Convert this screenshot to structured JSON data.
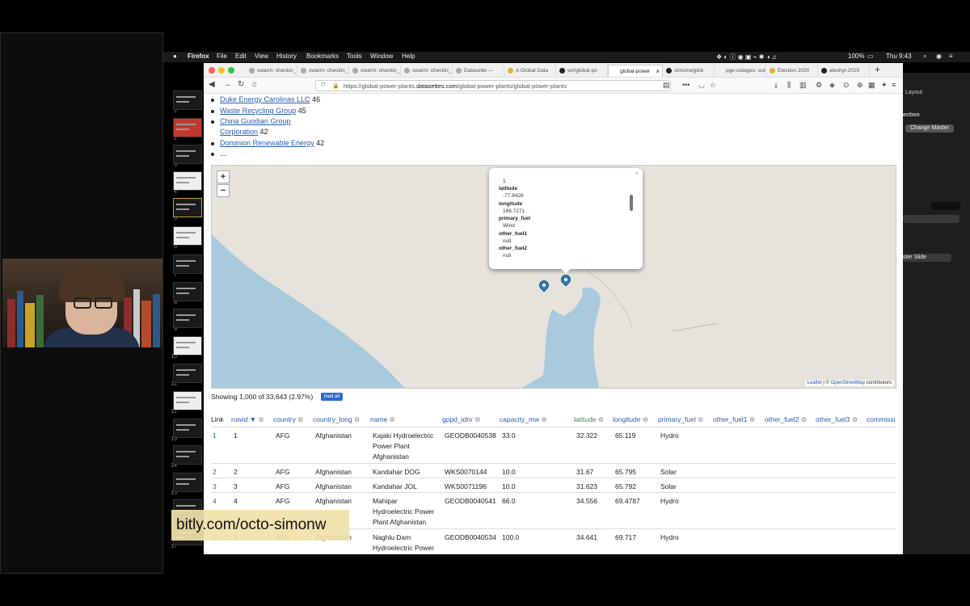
{
  "menubar": {
    "apple": "",
    "app": "Firefox",
    "items": [
      "File",
      "Edit",
      "View",
      "History",
      "Bookmarks",
      "Tools",
      "Window",
      "Help"
    ],
    "battery": "100%",
    "clock": "Thu 9:43"
  },
  "tabs": [
    {
      "label": "swarm: checkin_"
    },
    {
      "label": "swarm: checkin_"
    },
    {
      "label": "swarm: checkin_"
    },
    {
      "label": "swarm: checkin_"
    },
    {
      "label": "Datasette —"
    },
    {
      "label": "A Global Data"
    },
    {
      "label": "wri/global-po"
    },
    {
      "label": "global-power",
      "active": true
    },
    {
      "label": "simonw/glob"
    },
    {
      "label": "pge-outages: out"
    },
    {
      "label": "Election 2020"
    },
    {
      "label": "alexhyt-2020"
    }
  ],
  "url": {
    "prefix": "https://global-power-plants.",
    "domain": "datasettes.com",
    "path": "/global-power-plants/global-power-plants"
  },
  "owners": [
    {
      "name": "Duke Energy Carolinas LLC",
      "count": "46"
    },
    {
      "name": "Waste Recycling Group",
      "count": "45"
    },
    {
      "name": "China Guodian Group",
      "name2": "Corporation",
      "count": "42"
    },
    {
      "name": "Dominion Renewable Energy",
      "count": "42"
    },
    {
      "name": "..."
    }
  ],
  "map": {
    "zoom_in": "+",
    "zoom_out": "−",
    "popup": {
      "close": "×",
      "top_value": "1",
      "fields": [
        {
          "key": "latitude",
          "value": "-77.8428"
        },
        {
          "key": "longitude",
          "value": "166.7271"
        },
        {
          "key": "primary_fuel",
          "value": "Wind"
        },
        {
          "key": "other_fuel1",
          "value": "null"
        },
        {
          "key": "other_fuel2",
          "value": "null"
        }
      ]
    },
    "attribution": {
      "leaflet": "Leaflet",
      "sep": " | © ",
      "osm": "OpenStreetMap",
      "suffix": " contributors"
    }
  },
  "summary": {
    "showing": "Showing 1,000 of 33,643 (2.97%)",
    "load_all": "load all"
  },
  "table": {
    "headers": [
      "Link",
      "rowid ▼",
      "country",
      "country_long",
      "name",
      "gppd_idnr",
      "capacity_mw",
      "latitude",
      "longitude",
      "primary_fuel",
      "other_fuel1",
      "other_fuel2",
      "other_fuel3",
      "commissi"
    ],
    "rows": [
      {
        "link": "1",
        "rowid": "1",
        "country": "AFG",
        "country_long": "Afghanistan",
        "name": [
          "Kajaki Hydroelectric",
          "Power Plant",
          "Afghanistan"
        ],
        "gppd_idnr": "GEODB0040538",
        "capacity_mw": "33.0",
        "latitude": "32.322",
        "longitude": "65.119",
        "primary_fuel": "Hydro"
      },
      {
        "link": "2",
        "rowid": "2",
        "country": "AFG",
        "country_long": "Afghanistan",
        "name": [
          "Kandahar DOG"
        ],
        "gppd_idnr": "WKS0070144",
        "capacity_mw": "10.0",
        "latitude": "31.67",
        "longitude": "65.795",
        "primary_fuel": "Solar"
      },
      {
        "link": "3",
        "rowid": "3",
        "country": "AFG",
        "country_long": "Afghanistan",
        "name": [
          "Kandahar JOL"
        ],
        "gppd_idnr": "WKS0071196",
        "capacity_mw": "10.0",
        "latitude": "31.623",
        "longitude": "65.792",
        "primary_fuel": "Solar"
      },
      {
        "link": "4",
        "rowid": "4",
        "country": "AFG",
        "country_long": "Afghanistan",
        "name": [
          "Mahipar",
          "Hydroelectric Power",
          "Plant Afghanistan"
        ],
        "gppd_idnr": "GEODB0040541",
        "capacity_mw": "66.0",
        "latitude": "34.556",
        "longitude": "69.4787",
        "primary_fuel": "Hydro"
      },
      {
        "link": "5",
        "rowid": "5",
        "country": "AFG",
        "country_long": "Afghanistan",
        "name": [
          "Naghlu Dam",
          "Hydroelectric Power"
        ],
        "gppd_idnr": "GEODB0040534",
        "capacity_mw": "100.0",
        "latitude": "34.641",
        "longitude": "69.717",
        "primary_fuel": "Hydro"
      }
    ]
  },
  "keynote": {
    "layout": "Layout",
    "section": "ection",
    "change_master": "Change Master",
    "master_slide": "ster Slide",
    "slide_numbers": [
      "1",
      "2",
      "3",
      "4",
      "5",
      "6",
      "7",
      "8",
      "9",
      "10",
      "11",
      "12",
      "13",
      "14",
      "15",
      "16",
      "17"
    ]
  },
  "banner": "bitly.com/octo-simonw"
}
